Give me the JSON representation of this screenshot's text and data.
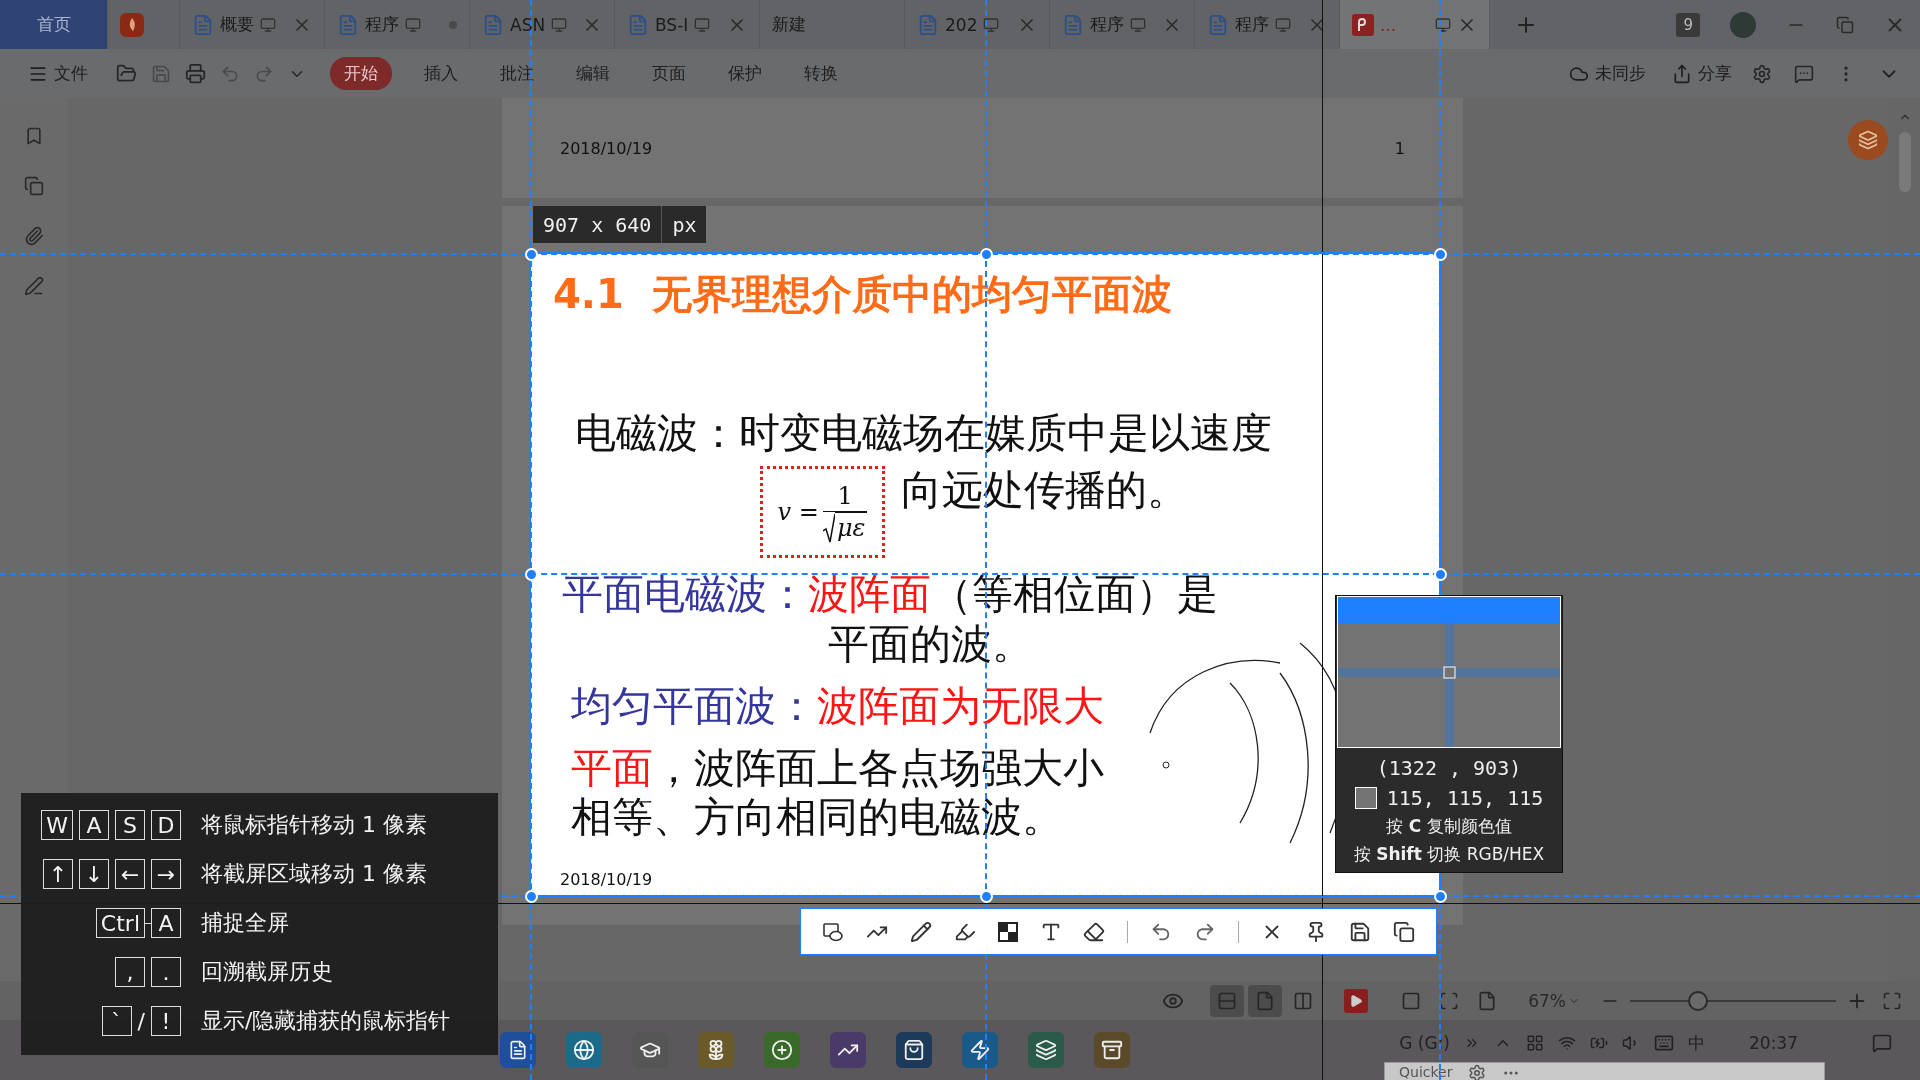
{
  "tab_bar": {
    "tabs": [
      {
        "kind": "home",
        "label": "首页",
        "selected": false,
        "closable": false,
        "modified": false
      },
      {
        "kind": "app",
        "selected": false,
        "closable": false,
        "modified": false
      },
      {
        "kind": "doc",
        "label": "概要",
        "selected": false,
        "closable": true,
        "modified": false
      },
      {
        "kind": "doc",
        "label": "程序",
        "selected": false,
        "closable": false,
        "modified": true
      },
      {
        "kind": "doc",
        "label": "ASN",
        "selected": false,
        "closable": true,
        "modified": false
      },
      {
        "kind": "doc",
        "label": "BS-I",
        "selected": false,
        "closable": true,
        "modified": false
      },
      {
        "kind": "new",
        "label": "新建",
        "selected": false,
        "closable": false,
        "modified": false
      },
      {
        "kind": "doc",
        "label": "202",
        "selected": false,
        "closable": true,
        "modified": false
      },
      {
        "kind": "doc",
        "label": "程序",
        "selected": false,
        "closable": true,
        "modified": false
      },
      {
        "kind": "doc",
        "label": "程序",
        "selected": false,
        "closable": true,
        "modified": false
      },
      {
        "kind": "pdf",
        "label": "...",
        "selected": true,
        "closable": true,
        "modified": false
      }
    ],
    "window_count": "9"
  },
  "menu_bar": {
    "file_label": "文件",
    "tabs": [
      {
        "label": "开始",
        "selected": true
      },
      {
        "label": "插入",
        "selected": false
      },
      {
        "label": "批注",
        "selected": false
      },
      {
        "label": "编辑",
        "selected": false
      },
      {
        "label": "页面",
        "selected": false
      },
      {
        "label": "保护",
        "selected": false
      },
      {
        "label": "转换",
        "selected": false
      }
    ],
    "actions": [
      "未同步",
      "分享"
    ]
  },
  "document": {
    "page_1": {
      "date": "2018/10/19",
      "page_number": "1"
    },
    "slide": {
      "title": "4.1  无界理想介质中的均匀平面波",
      "lines": [
        {
          "kind": "text",
          "segments": [
            {
              "kind": "plain",
              "text": "电磁波：时变电磁场在媒质中是以速度"
            }
          ]
        },
        {
          "kind": "formula",
          "formula": {
            "lhs": "v =",
            "numerator": "1",
            "radicand": "με"
          },
          "segments": [
            {
              "kind": "plain",
              "text": "向远处传播的。"
            }
          ]
        },
        {
          "kind": "text",
          "segments": [
            {
              "kind": "term",
              "text": "平面电磁波："
            },
            {
              "kind": "emphasis",
              "text": "波阵面"
            },
            {
              "kind": "plain",
              "text": "（等相位面）是"
            }
          ]
        },
        {
          "kind": "text",
          "segments": [
            {
              "kind": "plain",
              "text": "平面的波。"
            }
          ]
        },
        {
          "kind": "text",
          "segments": [
            {
              "kind": "term",
              "text": "均匀平面波："
            },
            {
              "kind": "emphasis",
              "text": "波阵面为无限大"
            }
          ]
        },
        {
          "kind": "text",
          "segments": [
            {
              "kind": "emphasis",
              "text": "平面"
            },
            {
              "kind": "plain",
              "text": "，波阵面上各点场强大小"
            }
          ]
        },
        {
          "kind": "text",
          "segments": [
            {
              "kind": "plain",
              "text": "相等、方向相同的电磁波。"
            }
          ]
        }
      ],
      "date": "2018/10/19"
    }
  },
  "capture": {
    "size": "907 x 640",
    "unit": "px"
  },
  "magnifier": {
    "coordinates": "(1322 , 903)",
    "color_value": "115, 115, 115",
    "hints": [
      "按 **C** 复制颜色值",
      "按 **Shift** 切换 RGB/HEX"
    ]
  },
  "shortcuts": [
    {
      "kind": "single",
      "keys": [
        "W",
        "A",
        "S",
        "D"
      ],
      "description": "将鼠标指针移动 1 像素"
    },
    {
      "kind": "single",
      "keys": [
        "↑",
        "↓",
        "←",
        "→"
      ],
      "description": "将截屏区域移动 1 像素"
    },
    {
      "kind": "combo",
      "keys": [
        "Ctrl",
        "A"
      ],
      "description": "捕捉全屏"
    },
    {
      "kind": "single",
      "keys": [
        ",",
        "."
      ],
      "description": "回溯截屏历史"
    },
    {
      "kind": "alternative",
      "keys": [
        "`",
        "!"
      ],
      "joiner": "/",
      "description": "显示/隐藏捕获的鼠标指针"
    }
  ],
  "status_bar": {
    "view_modes": [
      {
        "selected": true
      },
      {
        "selected": true
      },
      {
        "selected": false
      }
    ],
    "zoom": "67%",
    "zoom_slider": {
      "level": 0.33
    }
  },
  "taskbar": {
    "drive": "G (G:)",
    "ime": "中",
    "time": "20:37"
  },
  "quicker_window": {
    "title": "Quicker"
  }
}
